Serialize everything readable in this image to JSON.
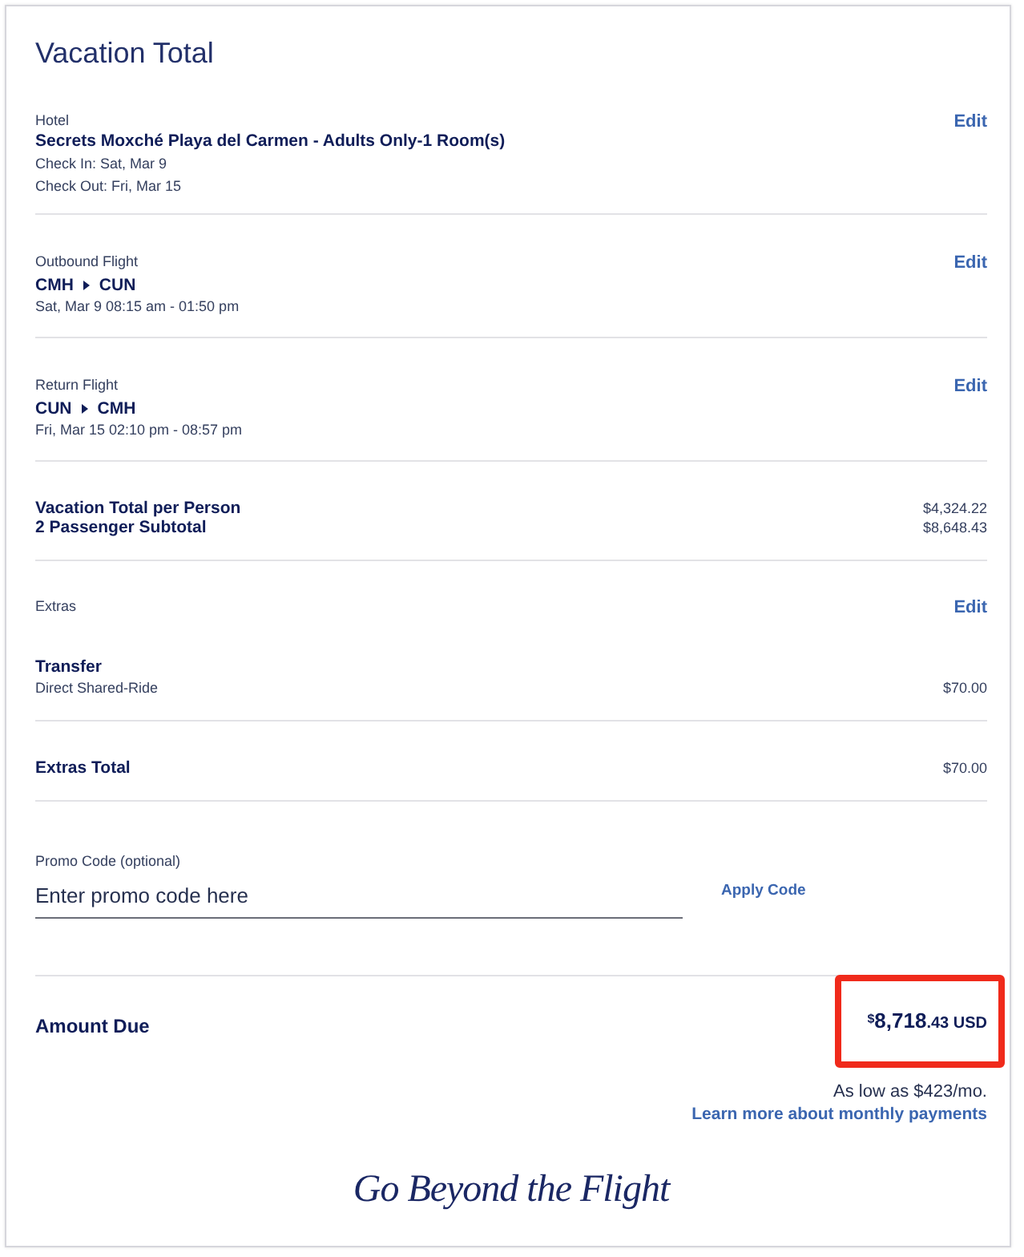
{
  "title": "Vacation Total",
  "sections": [
    {
      "kind": "stay",
      "label": "Hotel",
      "name": "Secrets Moxché Playa del Carmen - Adults Only-1 Room(s)",
      "details": [
        "Check In: Sat, Mar 9",
        "Check Out: Fri, Mar 15"
      ],
      "action": "Edit"
    },
    {
      "kind": "flight",
      "label": "Outbound Flight",
      "route": {
        "from": "CMH",
        "to": "CUN"
      },
      "details": [
        "Sat, Mar 9 08:15 am - 01:50 pm"
      ],
      "action": "Edit"
    },
    {
      "kind": "flight",
      "label": "Return Flight",
      "route": {
        "from": "CUN",
        "to": "CMH"
      },
      "details": [
        "Fri, Mar 15 02:10 pm - 08:57 pm"
      ],
      "action": "Edit"
    },
    {
      "kind": "totals",
      "rows": [
        {
          "label": "Vacation Total per Person",
          "value": "$4,324.22"
        },
        {
          "label": "2 Passenger Subtotal",
          "value": "$8,648.43"
        }
      ]
    },
    {
      "kind": "extras",
      "label": "Extras",
      "action": "Edit",
      "items": [
        {
          "name": "Transfer",
          "detail": "Direct Shared-Ride",
          "price": "$70.00"
        }
      ]
    },
    {
      "kind": "totals",
      "rows": [
        {
          "label": "Extras Total",
          "value": "$70.00"
        }
      ]
    }
  ],
  "promo": {
    "label": "Promo Code (optional)",
    "placeholder": "Enter promo code here",
    "button": "Apply Code"
  },
  "amount_due": {
    "label": "Amount Due",
    "currency": "$",
    "whole": "8,718",
    "cents": ".43",
    "code": "USD",
    "highlighted": true,
    "installment": "As low as $423/mo.",
    "link": "Learn more about monthly payments"
  },
  "tagline": "Go Beyond the Flight"
}
